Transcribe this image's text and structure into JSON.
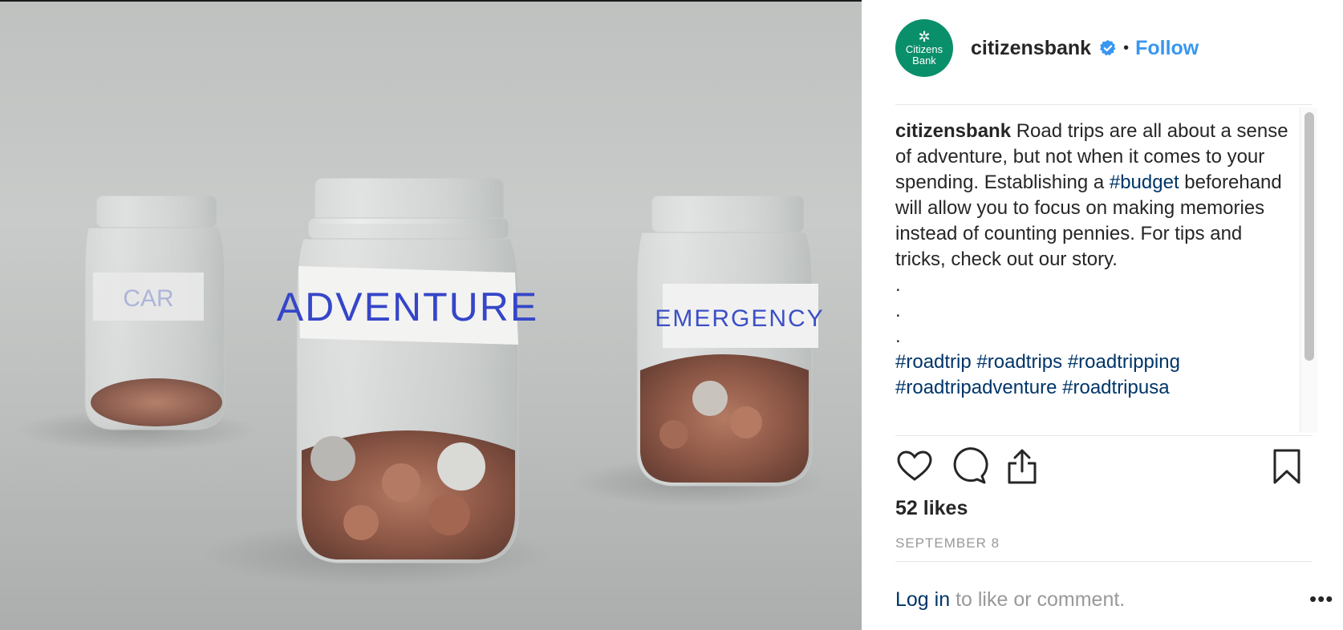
{
  "post": {
    "image_alt_labels": {
      "left_jar_label": "CAR",
      "center_jar_label": "ADVENTURE",
      "right_jar_label": "EMERGENCY"
    },
    "avatar": {
      "logo_text_line1": "Citizens",
      "logo_text_line2": "Bank",
      "color": "#0a8f6b"
    },
    "header": {
      "username": "citizensbank",
      "separator": "•",
      "follow_label": "Follow"
    },
    "caption": {
      "username": "citizensbank",
      "text_part1": " Road trips are all about a sense of adventure, but not when it comes to your spending. Establishing a ",
      "hashtag_budget": "#budget",
      "text_part2": " beforehand will allow you to focus on making memories instead of counting pennies. For tips and tricks, check out our story.",
      "dot1": ".",
      "dot2": ".",
      "dot3": ".",
      "hashtags_line1": [
        "#roadtrip",
        "#roadtrips",
        "#roadtripping"
      ],
      "hashtags_line2": [
        "#roadtripadventure",
        "#roadtripusa"
      ]
    },
    "actions": {
      "like_icon": "heart-icon",
      "comment_icon": "comment-icon",
      "share_icon": "share-icon",
      "save_icon": "bookmark-icon"
    },
    "likes": "52 likes",
    "date": "SEPTEMBER 8",
    "comment_bar": {
      "login_label": "Log in",
      "prompt": " to like or comment.",
      "more_label": "•••"
    },
    "colors": {
      "link_blue": "#3897f0",
      "hashtag_blue": "#003569",
      "muted": "#999999"
    }
  }
}
